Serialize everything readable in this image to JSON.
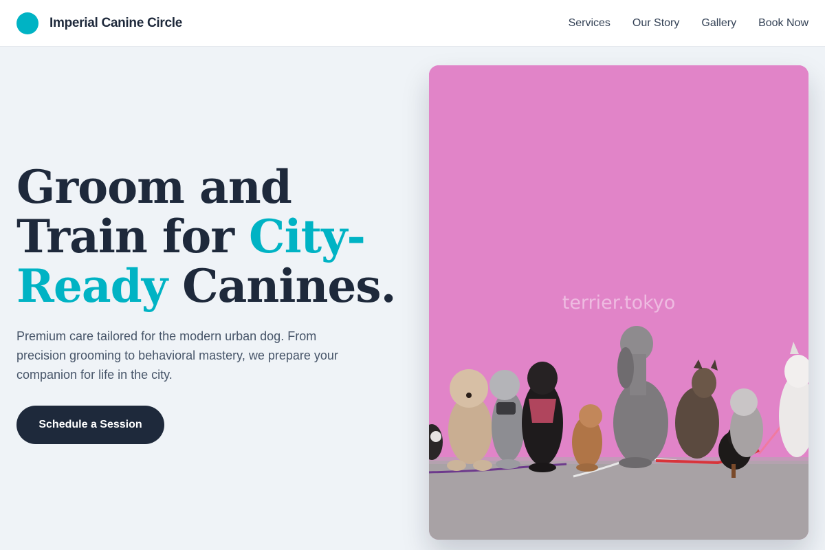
{
  "brand": {
    "name": "Imperial Canine Circle",
    "accent_color": "#00b3c4",
    "dark_color": "#1e293b"
  },
  "nav": {
    "items": [
      "Services",
      "Our Story",
      "Gallery",
      "Book Now"
    ]
  },
  "hero": {
    "title_part1": "Groom and",
    "title_part2": "Train for ",
    "title_accent": "City-",
    "title_accent2": "Ready",
    "title_part3": " Canines.",
    "subtitle": "Premium care tailored for the modern urban dog. From precision grooming to behavioral mastery, we prepare your companion for life in the city.",
    "cta_label": "Schedule a Session"
  },
  "photo": {
    "watermark": "terrier.tokyo",
    "wall_color": "#e184c8",
    "ground_color": "#a8a2a5"
  }
}
